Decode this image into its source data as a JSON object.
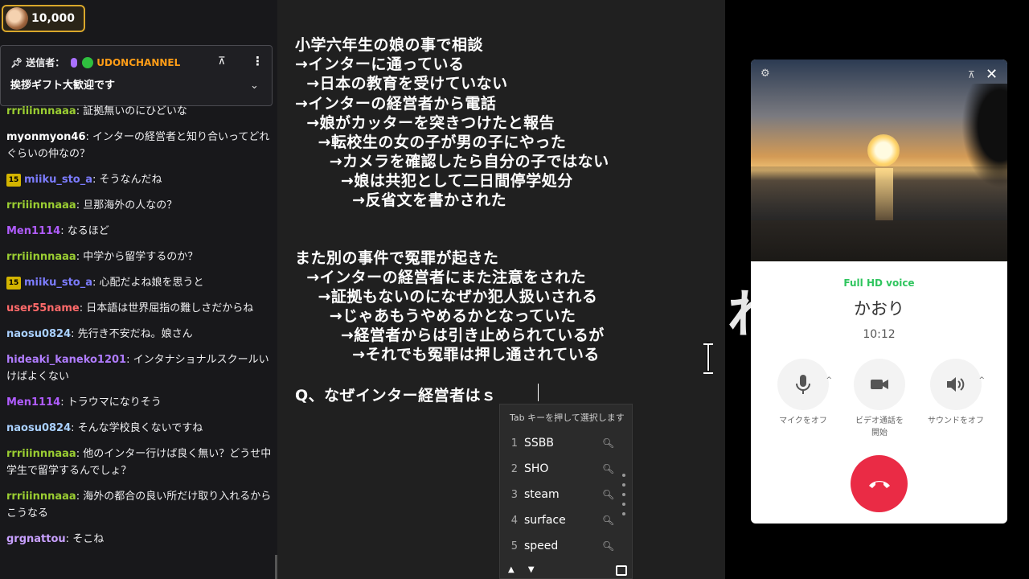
{
  "chat": {
    "viewer_count": "10,000",
    "pinned": {
      "sender_label": "送信者：",
      "channel": "UDONCHANNEL",
      "message": "挨拶ギフト大歓迎です"
    },
    "messages": [
      {
        "user": "rrriiinnnaaa",
        "color": "#9acd32",
        "text": "証拠無いのにひどいな",
        "sub": ""
      },
      {
        "user": "myonmyon46",
        "color": "#ffffff",
        "text": "インターの経営者と知り合いってどれぐらいの仲なの？",
        "sub": ""
      },
      {
        "user": "miiku_sto_a",
        "color": "#7c7cff",
        "text": "そうなんだね",
        "sub": "15"
      },
      {
        "user": "rrriiinnnaaa",
        "color": "#9acd32",
        "text": "旦那海外の人なの？",
        "sub": ""
      },
      {
        "user": "Men1114",
        "color": "#b05cff",
        "text": "なるほど",
        "sub": ""
      },
      {
        "user": "rrriiinnnaaa",
        "color": "#9acd32",
        "text": "中学から留学するのか？",
        "sub": ""
      },
      {
        "user": "miiku_sto_a",
        "color": "#7c7cff",
        "text": "心配だよね娘を思うと",
        "sub": "15"
      },
      {
        "user": "user55name",
        "color": "#ff6a6a",
        "text": "日本語は世界屈指の難しさだからね",
        "sub": ""
      },
      {
        "user": "naosu0824",
        "color": "#a9d0ff",
        "text": "先行き不安だね。娘さん",
        "sub": ""
      },
      {
        "user": "hideaki_kaneko1201",
        "color": "#b07cff",
        "text": "インタナショナルスクールいけばよくない",
        "sub": ""
      },
      {
        "user": "Men1114",
        "color": "#b05cff",
        "text": "トラウマになりそう",
        "sub": ""
      },
      {
        "user": "naosu0824",
        "color": "#a9d0ff",
        "text": "そんな学校良くないですね",
        "sub": ""
      },
      {
        "user": "rrriiinnnaaa",
        "color": "#9acd32",
        "text": "他のインター行けば良く無い？どうせ中学生で留学するんでしょ？",
        "sub": ""
      },
      {
        "user": "rrriiinnnaaa",
        "color": "#9acd32",
        "text": "海外の都合の良い所だけ取り入れるからこうなる",
        "sub": ""
      },
      {
        "user": "grgnattou",
        "color": "#c8a0ff",
        "text": "そこね",
        "sub": ""
      }
    ]
  },
  "editor": {
    "lines": [
      "小学六年生の娘の事で相談",
      "→インターに通っている",
      "  →日本の教育を受けていない",
      "→インターの経営者から電話",
      "  →娘がカッターを突きつけたと報告",
      "    →転校生の女の子が男の子にやった",
      "      →カメラを確認したら自分の子ではない",
      "        →娘は共犯として二日間停学処分",
      "          →反省文を書かされた",
      "また別の事件で冤罪が起きた",
      "  →インターの経営者にまた注意をされた",
      "    →証拠もないのになぜか犯人扱いされる",
      "      →じゃあもうやめるかとなっていた",
      "        →経営者からは引き止められているが",
      "          →それでも冤罪は押し通されている",
      "Q、なぜインター経営者はｓ"
    ]
  },
  "ime": {
    "hint": "Tab キーを押して選択します",
    "candidates": [
      {
        "num": "1",
        "word": "SSBB"
      },
      {
        "num": "2",
        "word": "SHO"
      },
      {
        "num": "3",
        "word": "steam"
      },
      {
        "num": "4",
        "word": "surface"
      },
      {
        "num": "5",
        "word": "speed"
      }
    ]
  },
  "call": {
    "quality": "Full HD voice",
    "callee": "かおり",
    "duration": "10:12",
    "controls": [
      {
        "label": "マイクをオフ",
        "icon": "microphone-icon"
      },
      {
        "label": "ビデオ通話を\n開始",
        "icon": "video-camera-icon"
      },
      {
        "label": "サウンドをオフ",
        "icon": "speaker-icon"
      }
    ],
    "hangup_color": "#ea2b45",
    "quality_color": "#2fc55e"
  },
  "overlay_char": "れ"
}
